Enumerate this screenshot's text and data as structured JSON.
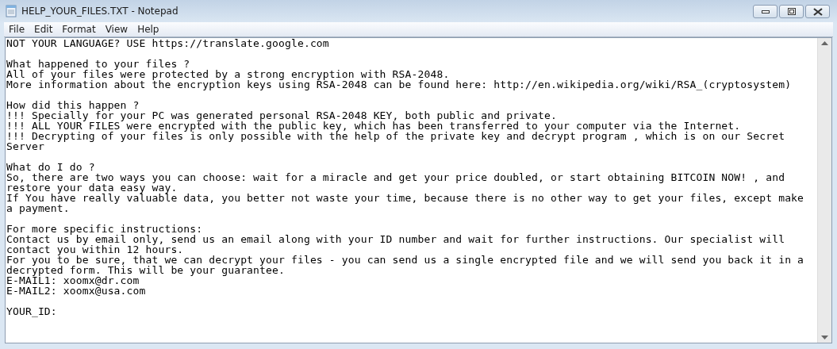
{
  "window": {
    "title": "HELP_YOUR_FILES.TXT - Notepad"
  },
  "menu": [
    "File",
    "Edit",
    "Format",
    "View",
    "Help"
  ],
  "document": {
    "paragraphs": [
      [
        "NOT YOUR LANGUAGE? USE https://translate.google.com"
      ],
      [
        "What happened to your files ?",
        "All of your files were protected by a strong encryption with RSA-2048.",
        "More information about the encryption keys using RSA-2048 can be found here: http://en.wikipedia.org/wiki/RSA_(cryptosystem)"
      ],
      [
        "How did this happen ?",
        "!!! Specially for your PC was generated personal RSA-2048 KEY, both public and private.",
        "!!! ALL YOUR FILES were encrypted with the public key, which has been transferred to your computer via the Internet.",
        "!!! Decrypting of your files is only possible with the help of the private key and decrypt program , which is on our Secret",
        "Server"
      ],
      [
        "What do I do ?",
        "So, there are two ways you can choose: wait for a miracle and get your price doubled, or start obtaining BITCOIN NOW! , and",
        "restore your data easy way.",
        "If You have really valuable data, you better not waste your time, because there is no other way to get your files, except make",
        "a payment."
      ],
      [
        "For more specific instructions:",
        "Contact us by email only, send us an email along with your ID number and wait for further instructions. Our specialist will",
        "contact you within 12 hours.",
        "For you to be sure, that we can decrypt your files - you can send us a single encrypted file and we will send you back it in a",
        "decrypted form. This will be your guarantee.",
        "E-MAIL1: xoomx@dr.com",
        "E-MAIL2: xoomx@usa.com"
      ],
      [
        "YOUR_ID:"
      ]
    ]
  }
}
